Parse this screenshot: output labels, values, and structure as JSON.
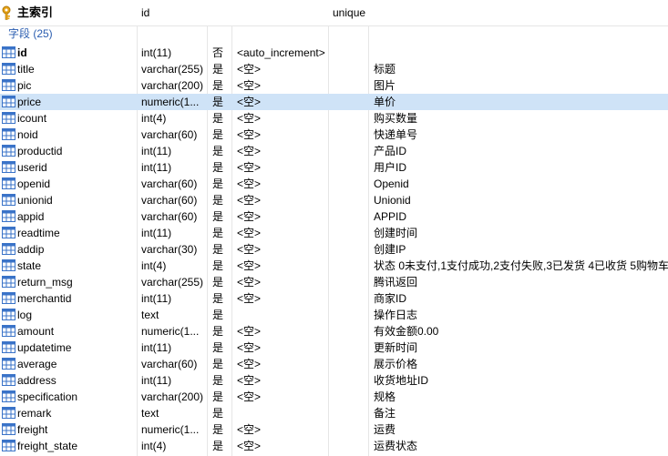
{
  "header": {
    "index_title": "主索引",
    "col_type": "id",
    "col_constraint": "unique"
  },
  "section": {
    "label": "字段 (25)"
  },
  "fields": [
    {
      "name": "id",
      "type": "int(11)",
      "null": "否",
      "default": "<auto_increment>",
      "comment": "",
      "bold": true
    },
    {
      "name": "title",
      "type": "varchar(255)",
      "null": "是",
      "default": "<空>",
      "comment": "标题"
    },
    {
      "name": "pic",
      "type": "varchar(200)",
      "null": "是",
      "default": "<空>",
      "comment": "图片"
    },
    {
      "name": "price",
      "type": "numeric(1...",
      "null": "是",
      "default": "<空>",
      "comment": "单价",
      "selected": true
    },
    {
      "name": "icount",
      "type": "int(4)",
      "null": "是",
      "default": "<空>",
      "comment": "购买数量"
    },
    {
      "name": "noid",
      "type": "varchar(60)",
      "null": "是",
      "default": "<空>",
      "comment": "快递单号"
    },
    {
      "name": "productid",
      "type": "int(11)",
      "null": "是",
      "default": "<空>",
      "comment": "产品ID"
    },
    {
      "name": "userid",
      "type": "int(11)",
      "null": "是",
      "default": "<空>",
      "comment": "用户ID"
    },
    {
      "name": "openid",
      "type": "varchar(60)",
      "null": "是",
      "default": "<空>",
      "comment": "Openid"
    },
    {
      "name": "unionid",
      "type": "varchar(60)",
      "null": "是",
      "default": "<空>",
      "comment": "Unionid"
    },
    {
      "name": "appid",
      "type": "varchar(60)",
      "null": "是",
      "default": "<空>",
      "comment": "APPID"
    },
    {
      "name": "readtime",
      "type": "int(11)",
      "null": "是",
      "default": "<空>",
      "comment": "创建时间"
    },
    {
      "name": "addip",
      "type": "varchar(30)",
      "null": "是",
      "default": "<空>",
      "comment": "创建IP"
    },
    {
      "name": "state",
      "type": "int(4)",
      "null": "是",
      "default": "<空>",
      "comment": "状态 0未支付,1支付成功,2支付失败,3已发货 4已收货 5购物车"
    },
    {
      "name": "return_msg",
      "type": "varchar(255)",
      "null": "是",
      "default": "<空>",
      "comment": "腾讯返回"
    },
    {
      "name": "merchantid",
      "type": "int(11)",
      "null": "是",
      "default": "<空>",
      "comment": "商家ID"
    },
    {
      "name": "log",
      "type": "text",
      "null": "是",
      "default": "",
      "comment": "操作日志"
    },
    {
      "name": "amount",
      "type": "numeric(1...",
      "null": "是",
      "default": "<空>",
      "comment": "有效金额0.00"
    },
    {
      "name": "updatetime",
      "type": "int(11)",
      "null": "是",
      "default": "<空>",
      "comment": "更新时间"
    },
    {
      "name": "average",
      "type": "varchar(60)",
      "null": "是",
      "default": "<空>",
      "comment": "展示价格"
    },
    {
      "name": "address",
      "type": "int(11)",
      "null": "是",
      "default": "<空>",
      "comment": "收货地址ID"
    },
    {
      "name": "specification",
      "type": "varchar(200)",
      "null": "是",
      "default": "<空>",
      "comment": "规格"
    },
    {
      "name": "remark",
      "type": "text",
      "null": "是",
      "default": "",
      "comment": "备注"
    },
    {
      "name": "freight",
      "type": "numeric(1...",
      "null": "是",
      "default": "<空>",
      "comment": "运费"
    },
    {
      "name": "freight_state",
      "type": "int(4)",
      "null": "是",
      "default": "<空>",
      "comment": "运费状态"
    }
  ],
  "colors": {
    "selected_row": "#cfe3f7",
    "section_label": "#2a5db0",
    "grid_line": "#e6e6e6",
    "field_icon": "#3a73c8",
    "key_icon": "#e8a317"
  },
  "icons": {
    "key": "key-icon",
    "field": "table-column-icon"
  }
}
